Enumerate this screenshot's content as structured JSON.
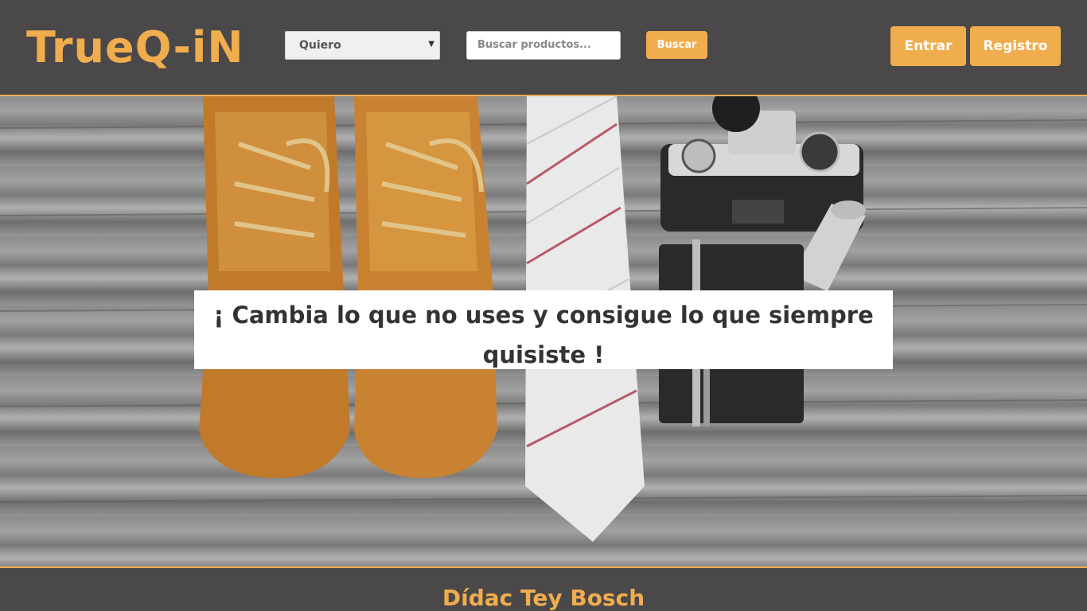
{
  "header": {
    "logo": "TrueQ-iN",
    "filter_select": {
      "selected": "Quiero"
    },
    "search": {
      "placeholder": "Buscar productos..."
    },
    "search_button": "Buscar",
    "login_button": "Entrar",
    "register_button": "Registro"
  },
  "hero": {
    "slogan": "¡ Cambia lo que no uses y consigue lo que siempre quisiste !",
    "image_description": "Leather boots, striped tie, camera, notebook with pen and rolled banknotes on a wooden table"
  },
  "footer": {
    "author": "Dídac Tey Bosch"
  },
  "colors": {
    "accent": "#f0ad4e",
    "header_bg": "#4a4849",
    "text_dark": "#333333"
  },
  "icons": [
    "chevron-down-icon"
  ]
}
